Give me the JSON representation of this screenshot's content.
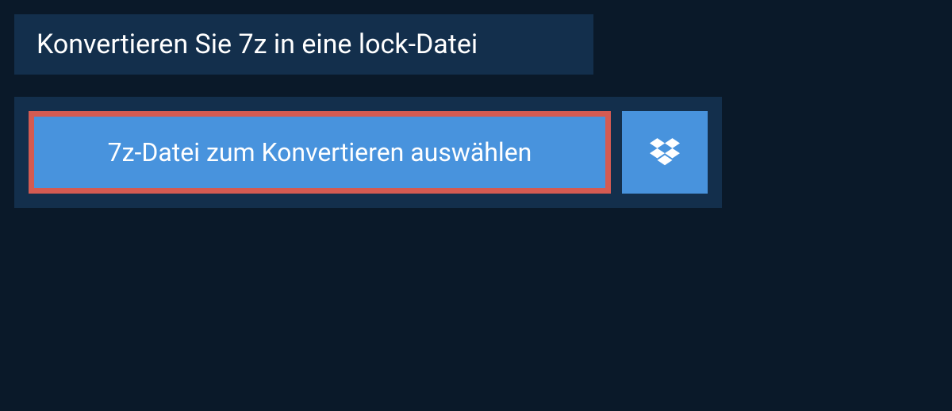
{
  "header": {
    "title": "Konvertieren Sie 7z in eine lock-Datei"
  },
  "upload": {
    "select_file_label": "7z-Datei zum Konvertieren auswählen"
  }
}
